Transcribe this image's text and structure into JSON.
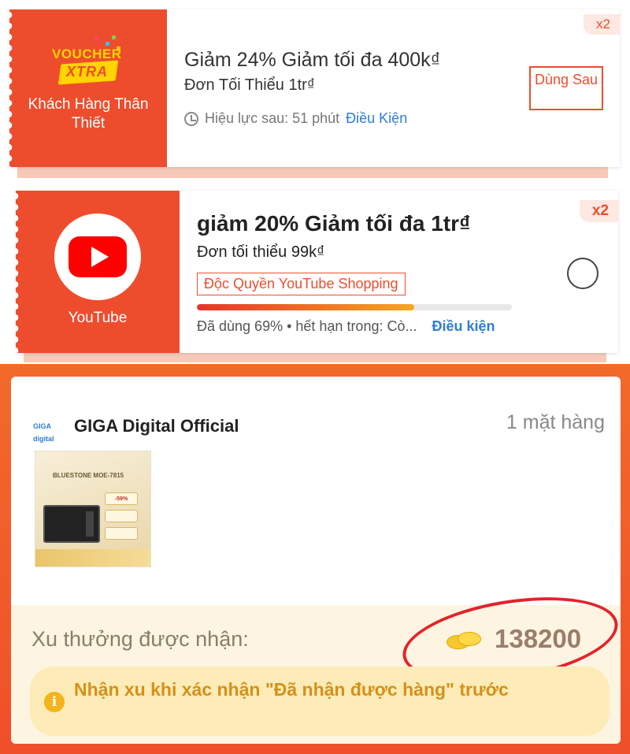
{
  "voucher1": {
    "brand_top": "VOUCHER",
    "brand_ribbon": "XTRA",
    "side_label": "Khách Hàng Thân Thiết",
    "title": "Giảm 24% Giảm tối đa 400k₫",
    "min_spend": "Đơn Tối Thiểu 1tr₫",
    "validity": "Hiệu lực sau: 51 phút",
    "conditions_link": "Điều Kiện",
    "button_label": "Dùng Sau",
    "quantity": "x2",
    "colors": {
      "accent": "#ee4d2d",
      "brand_yellow": "#ffd400"
    }
  },
  "voucher2": {
    "side_label": "YouTube",
    "title": "giảm 20% Giảm tối đa 1tr₫",
    "min_spend": "Đơn tối thiểu 99k₫",
    "tag": "Độc Quyền YouTube Shopping",
    "used_percent": 69,
    "usage_text": "Đã dùng 69% • hết hạn trong: Cò...",
    "conditions_link": "Điều kiện",
    "quantity": "x2",
    "selected": false
  },
  "shop": {
    "logo_text": "GIGA digital",
    "name": "GIGA Digital Official",
    "item_count": "1 mặt hàng",
    "product": {
      "brand_text": "BLUESTONE MOE-7815",
      "badge_text": "-59%"
    },
    "reward_label": "Xu thưởng được nhận:",
    "reward_amount": "138200",
    "notice_icon": "i",
    "notice_text": "Nhận xu khi xác nhận \"Đã nhận được hàng\" trước"
  }
}
